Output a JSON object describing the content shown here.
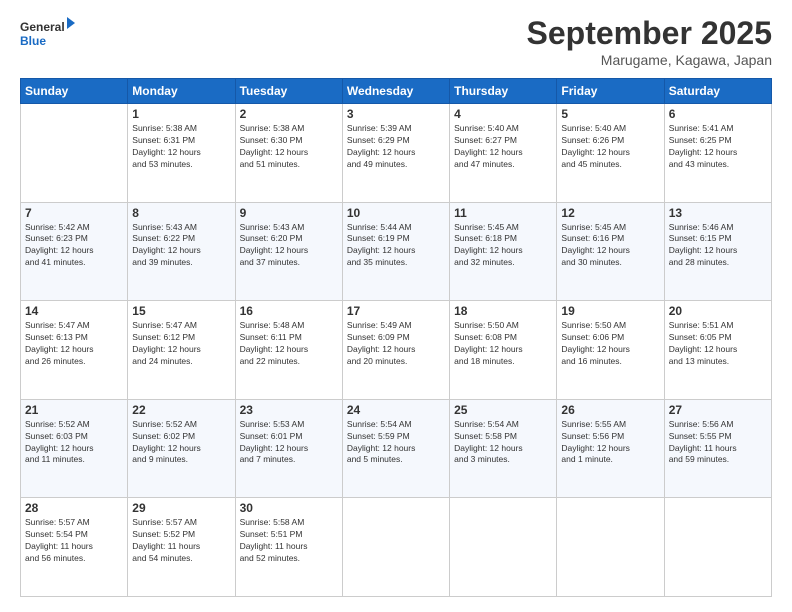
{
  "header": {
    "logo_line1": "General",
    "logo_line2": "Blue",
    "month": "September 2025",
    "location": "Marugame, Kagawa, Japan"
  },
  "weekdays": [
    "Sunday",
    "Monday",
    "Tuesday",
    "Wednesday",
    "Thursday",
    "Friday",
    "Saturday"
  ],
  "weeks": [
    [
      {
        "day": "",
        "info": ""
      },
      {
        "day": "1",
        "info": "Sunrise: 5:38 AM\nSunset: 6:31 PM\nDaylight: 12 hours\nand 53 minutes."
      },
      {
        "day": "2",
        "info": "Sunrise: 5:38 AM\nSunset: 6:30 PM\nDaylight: 12 hours\nand 51 minutes."
      },
      {
        "day": "3",
        "info": "Sunrise: 5:39 AM\nSunset: 6:29 PM\nDaylight: 12 hours\nand 49 minutes."
      },
      {
        "day": "4",
        "info": "Sunrise: 5:40 AM\nSunset: 6:27 PM\nDaylight: 12 hours\nand 47 minutes."
      },
      {
        "day": "5",
        "info": "Sunrise: 5:40 AM\nSunset: 6:26 PM\nDaylight: 12 hours\nand 45 minutes."
      },
      {
        "day": "6",
        "info": "Sunrise: 5:41 AM\nSunset: 6:25 PM\nDaylight: 12 hours\nand 43 minutes."
      }
    ],
    [
      {
        "day": "7",
        "info": "Sunrise: 5:42 AM\nSunset: 6:23 PM\nDaylight: 12 hours\nand 41 minutes."
      },
      {
        "day": "8",
        "info": "Sunrise: 5:43 AM\nSunset: 6:22 PM\nDaylight: 12 hours\nand 39 minutes."
      },
      {
        "day": "9",
        "info": "Sunrise: 5:43 AM\nSunset: 6:20 PM\nDaylight: 12 hours\nand 37 minutes."
      },
      {
        "day": "10",
        "info": "Sunrise: 5:44 AM\nSunset: 6:19 PM\nDaylight: 12 hours\nand 35 minutes."
      },
      {
        "day": "11",
        "info": "Sunrise: 5:45 AM\nSunset: 6:18 PM\nDaylight: 12 hours\nand 32 minutes."
      },
      {
        "day": "12",
        "info": "Sunrise: 5:45 AM\nSunset: 6:16 PM\nDaylight: 12 hours\nand 30 minutes."
      },
      {
        "day": "13",
        "info": "Sunrise: 5:46 AM\nSunset: 6:15 PM\nDaylight: 12 hours\nand 28 minutes."
      }
    ],
    [
      {
        "day": "14",
        "info": "Sunrise: 5:47 AM\nSunset: 6:13 PM\nDaylight: 12 hours\nand 26 minutes."
      },
      {
        "day": "15",
        "info": "Sunrise: 5:47 AM\nSunset: 6:12 PM\nDaylight: 12 hours\nand 24 minutes."
      },
      {
        "day": "16",
        "info": "Sunrise: 5:48 AM\nSunset: 6:11 PM\nDaylight: 12 hours\nand 22 minutes."
      },
      {
        "day": "17",
        "info": "Sunrise: 5:49 AM\nSunset: 6:09 PM\nDaylight: 12 hours\nand 20 minutes."
      },
      {
        "day": "18",
        "info": "Sunrise: 5:50 AM\nSunset: 6:08 PM\nDaylight: 12 hours\nand 18 minutes."
      },
      {
        "day": "19",
        "info": "Sunrise: 5:50 AM\nSunset: 6:06 PM\nDaylight: 12 hours\nand 16 minutes."
      },
      {
        "day": "20",
        "info": "Sunrise: 5:51 AM\nSunset: 6:05 PM\nDaylight: 12 hours\nand 13 minutes."
      }
    ],
    [
      {
        "day": "21",
        "info": "Sunrise: 5:52 AM\nSunset: 6:03 PM\nDaylight: 12 hours\nand 11 minutes."
      },
      {
        "day": "22",
        "info": "Sunrise: 5:52 AM\nSunset: 6:02 PM\nDaylight: 12 hours\nand 9 minutes."
      },
      {
        "day": "23",
        "info": "Sunrise: 5:53 AM\nSunset: 6:01 PM\nDaylight: 12 hours\nand 7 minutes."
      },
      {
        "day": "24",
        "info": "Sunrise: 5:54 AM\nSunset: 5:59 PM\nDaylight: 12 hours\nand 5 minutes."
      },
      {
        "day": "25",
        "info": "Sunrise: 5:54 AM\nSunset: 5:58 PM\nDaylight: 12 hours\nand 3 minutes."
      },
      {
        "day": "26",
        "info": "Sunrise: 5:55 AM\nSunset: 5:56 PM\nDaylight: 12 hours\nand 1 minute."
      },
      {
        "day": "27",
        "info": "Sunrise: 5:56 AM\nSunset: 5:55 PM\nDaylight: 11 hours\nand 59 minutes."
      }
    ],
    [
      {
        "day": "28",
        "info": "Sunrise: 5:57 AM\nSunset: 5:54 PM\nDaylight: 11 hours\nand 56 minutes."
      },
      {
        "day": "29",
        "info": "Sunrise: 5:57 AM\nSunset: 5:52 PM\nDaylight: 11 hours\nand 54 minutes."
      },
      {
        "day": "30",
        "info": "Sunrise: 5:58 AM\nSunset: 5:51 PM\nDaylight: 11 hours\nand 52 minutes."
      },
      {
        "day": "",
        "info": ""
      },
      {
        "day": "",
        "info": ""
      },
      {
        "day": "",
        "info": ""
      },
      {
        "day": "",
        "info": ""
      }
    ]
  ]
}
